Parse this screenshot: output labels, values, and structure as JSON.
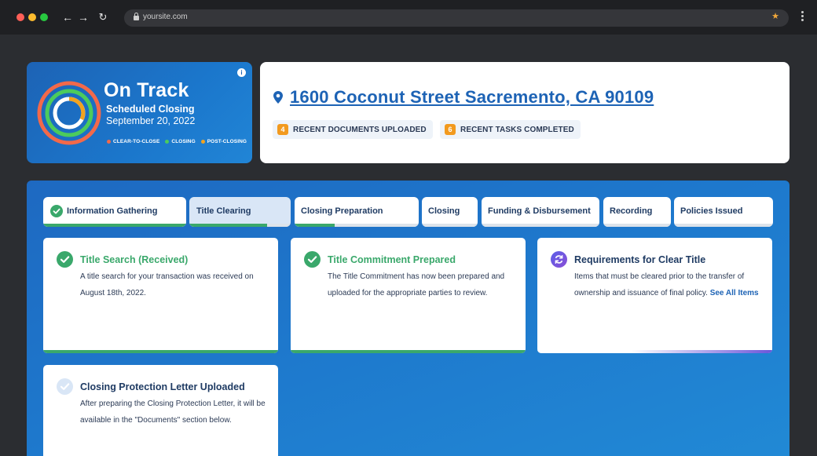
{
  "browser": {
    "url": "yoursite.com",
    "traffic_lights": [
      "#ff5f57",
      "#febc2e",
      "#28c840"
    ]
  },
  "status": {
    "title": "On Track",
    "subtitle": "Scheduled Closing",
    "date": "September 20, 2022",
    "info_icon": "i",
    "legend": [
      {
        "label": "CLEAR-TO-CLOSE",
        "color": "#f2694a"
      },
      {
        "label": "CLOSING",
        "color": "#4ccb5c"
      },
      {
        "label": "POST-CLOSING",
        "color": "#f2a31f"
      }
    ]
  },
  "property": {
    "address": "1600 Coconut Street Sacremento, CA 90109",
    "badges": [
      {
        "count": "4",
        "label": "RECENT DOCUMENTS UPLOADED"
      },
      {
        "count": "6",
        "label": "RECENT TASKS COMPLETED"
      }
    ]
  },
  "tabs": [
    {
      "label": "Information Gathering",
      "progress": 1.0,
      "completed": true,
      "active": false
    },
    {
      "label": "Title Clearing",
      "progress": 0.77,
      "completed": false,
      "active": true
    },
    {
      "label": "Closing Preparation",
      "progress": 0.32,
      "completed": false,
      "active": false
    },
    {
      "label": "Closing",
      "progress": 0,
      "completed": false,
      "active": false
    },
    {
      "label": "Funding & Disbursement",
      "progress": 0,
      "completed": false,
      "active": false
    },
    {
      "label": "Recording",
      "progress": 0,
      "completed": false,
      "active": false
    },
    {
      "label": "Policies Issued",
      "progress": 0,
      "completed": false,
      "active": false
    }
  ],
  "cards": [
    {
      "title": "Title Search (Received)",
      "description": "A title search for your transaction was received on August 18th, 2022.",
      "status": "complete",
      "title_color": "#3aa86b",
      "bar_color": "#3aa86b"
    },
    {
      "title": "Title Commitment Prepared",
      "description": "The Title Commitment has now been prepared and uploaded for the appropriate parties to review.",
      "status": "complete",
      "title_color": "#3aa86b",
      "bar_color": "#3aa86b"
    },
    {
      "title": "Requirements for Clear Title",
      "description": "Items that must be cleared prior to the transfer of ownership and issuance of final policy.",
      "link": "See All Items",
      "status": "in-progress",
      "title_color": "#1f3b63",
      "bar_color": "#6b55d9"
    },
    {
      "title": "Closing Protection Letter Uploaded",
      "description": "After preparing the Closing Protection Letter, it will be available in the \"Documents\" section below.",
      "status": "pending",
      "title_color": "#1f3b63",
      "bar_color": "#dde3ea"
    }
  ]
}
